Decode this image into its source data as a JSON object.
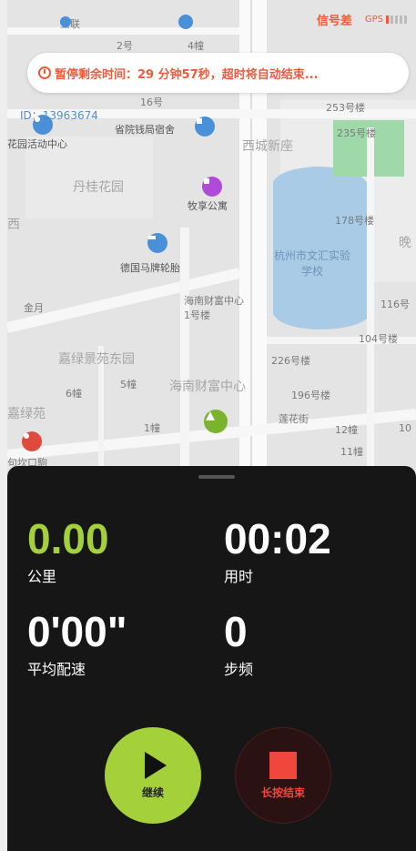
{
  "status_bar": {
    "signal_text": "信号差",
    "gps_label": "GPS",
    "gps_level": 0.2
  },
  "banner": {
    "text": "暂停剩余时间：29 分钟57秒，超时将自动结束..."
  },
  "map": {
    "labels": {
      "wulian": "五联",
      "l2": "2号",
      "l4": "4幢",
      "id_text": "ID：13963674",
      "l16": "16号",
      "activity_center": "花园活动中心",
      "apartment_office": "省院钱局宿舍",
      "xicheng": "西城新座",
      "danguihuayuan": "丹桂花园",
      "muxiang": "牧享公寓",
      "school": "杭州市文汇实验学校",
      "de_tire": "德国马牌轮胎",
      "wealth_center_1": "海南财富中心1号楼",
      "jinyue": "金月",
      "jialvfang": "嘉绿景苑东园",
      "hainan_wealth": "海南财富中心",
      "l6": "6幢",
      "l5": "5幢",
      "l1": "1幢",
      "lianhua": "莲花街",
      "jialv": "嘉绿苑",
      "building_number": "253号楼",
      "b235": "235号楼",
      "b178": "178号楼",
      "b116": "116号",
      "b104": "104号楼",
      "b226": "226号楼",
      "b196": "196号楼",
      "b12": "12幢",
      "b11": "11幢",
      "b10": "10",
      "jiukou": "句坎口駒",
      "e": "晚",
      "xi": "西"
    }
  },
  "stats": {
    "distance": {
      "value": "0.00",
      "label": "公里"
    },
    "time": {
      "value": "00:02",
      "label": "用时"
    },
    "pace": {
      "value": "0'00\"",
      "label": "平均配速"
    },
    "cadence": {
      "value": "0",
      "label": "步频"
    }
  },
  "buttons": {
    "continue_label": "继续",
    "end_label": "长按结束"
  },
  "colors": {
    "accent": "#a4d13a",
    "alert": "#f05a3c",
    "stop": "#f0473c",
    "panel": "#161616"
  }
}
